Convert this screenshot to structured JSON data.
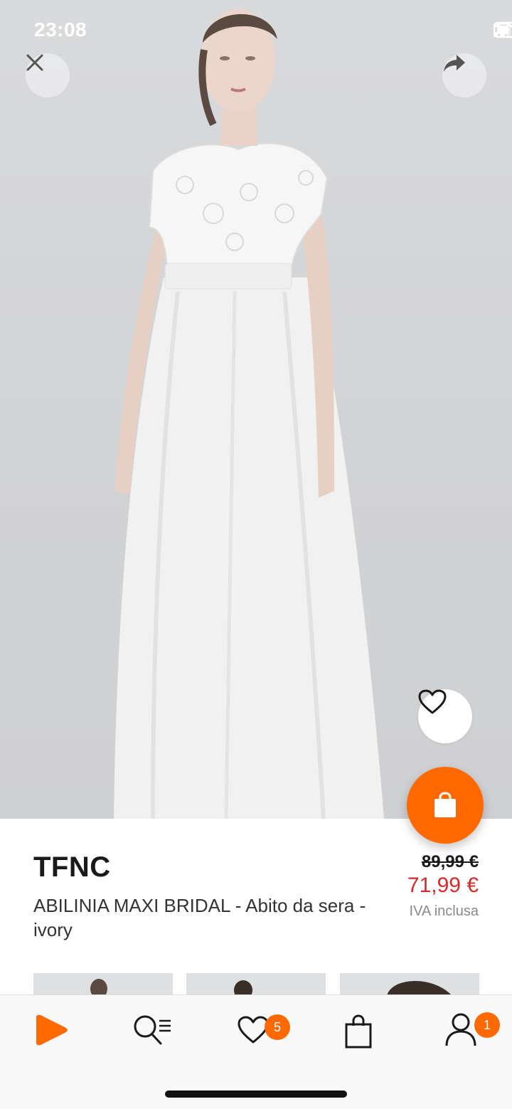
{
  "status_bar": {
    "time": "23:08"
  },
  "product": {
    "brand": "TFNC",
    "name": "ABILINIA MAXI BRIDAL - Abito da sera - ivory",
    "price_original": "89,99 €",
    "price_sale": "71,99 €",
    "vat_note": "IVA inclusa"
  },
  "nav": {
    "wishlist_count": "5",
    "profile_count": "1"
  },
  "colors": {
    "accent": "#ff6900",
    "sale": "#d72b2b"
  }
}
